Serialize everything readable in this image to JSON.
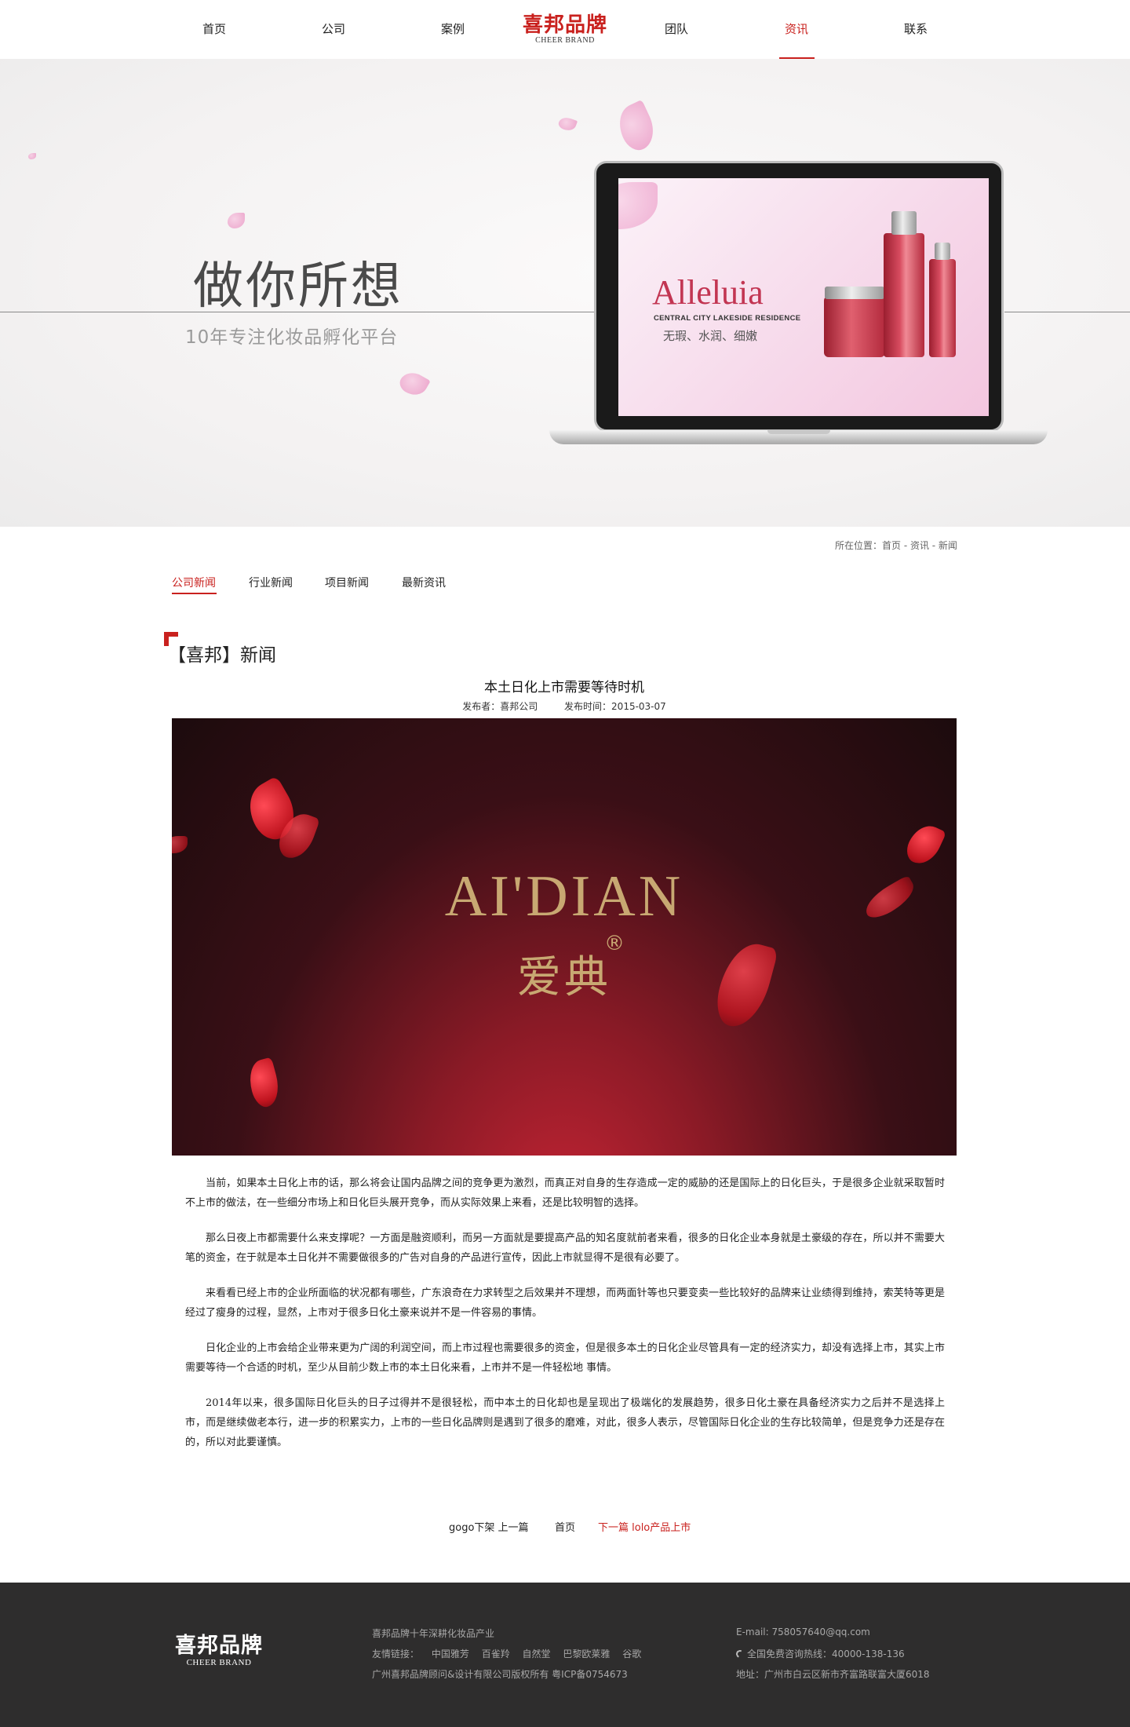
{
  "nav": {
    "items": [
      {
        "label": "首页"
      },
      {
        "label": "公司"
      },
      {
        "label": "案例"
      },
      {
        "label": "团队"
      },
      {
        "label": "资讯"
      },
      {
        "label": "联系"
      }
    ],
    "active_index": 4,
    "logo_cn": "喜邦品牌",
    "logo_en": "CHEER BRAND"
  },
  "banner": {
    "title": "做你所想",
    "subtitle": "10年专注化妆品孵化平台",
    "screen": {
      "brand": "Alleluia",
      "brand_sub": "CENTRAL CITY LAKESIDE RESIDENCE",
      "tagline": "无瑕、水润、细嫩"
    }
  },
  "breadcrumb": "所在位置：首页 - 资讯 - 新闻",
  "subnav": {
    "items": [
      {
        "label": "公司新闻"
      },
      {
        "label": "行业新闻"
      },
      {
        "label": "项目新闻"
      },
      {
        "label": "最新资讯"
      }
    ],
    "active_index": 0
  },
  "section_title": "【喜邦】新闻",
  "article": {
    "title": "本土日化上市需要等待时机",
    "publisher": "发布者：喜邦公司",
    "date": "发布时间：2015-03-07",
    "image": {
      "brand_en": "AI'DIAN",
      "brand_cn": "爱典",
      "reg_mark": "®"
    },
    "paragraphs": [
      "当前，如果本土日化上市的话，那么将会让国内品牌之间的竞争更为激烈，而真正对自身的生存造成一定的威胁的还是国际上的日化巨头，于是很多企业就采取暂时不上市的做法，在一些细分市场上和日化巨头展开竞争，而从实际效果上来看，还是比较明智的选择。",
      "那么日夜上市都需要什么来支撑呢？一方面是融资顺利，而另一方面就是要提高产品的知名度就前者来看，很多的日化企业本身就是土豪级的存在，所以并不需要大笔的资金，在于就是本土日化并不需要做很多的广告对自身的产品进行宣传，因此上市就显得不是很有必要了。",
      "来看看已经上市的企业所面临的状况都有哪些，广东浪奇在力求转型之后效果并不理想，而两面针等也只要变卖一些比较好的品牌来让业绩得到维持，索芙特等更是经过了瘦身的过程，显然，上市对于很多日化土豪来说并不是一件容易的事情。",
      "日化企业的上市会给企业带来更为广阔的利润空间，而上市过程也需要很多的资金，但是很多本土的日化企业尽管具有一定的经济实力，却没有选择上市，其实上市需要等待一个合适的时机，至少从目前少数上市的本土日化来看，上市并不是一件轻松地 事情。",
      "2014年以来，很多国际日化巨头的日子过得并不是很轻松，而中本土的日化却也是呈现出了极端化的发展趋势，很多日化土豪在具备经济实力之后并不是选择上市，而是继续做老本行，进一步的积累实力，上市的一些日化品牌则是遇到了很多的磨难，对此，很多人表示，尽管国际日化企业的生存比较简单，但是竞争力还是存在的，所以对此要谨慎。"
    ]
  },
  "pager": {
    "prev": "gogo下架  上一篇",
    "home": "首页",
    "next": "下一篇  lolo产品上市"
  },
  "footer": {
    "logo_cn": "喜邦品牌",
    "logo_en": "CHEER BRAND",
    "slogan": "喜邦品牌十年深耕化妆品产业",
    "links_label": "友情链接：",
    "links": [
      "中国雅芳",
      "百雀羚",
      "自然堂",
      "巴黎欧莱雅",
      "谷歌"
    ],
    "copyright": "广州喜邦品牌顾问&设计有限公司版权所有    粤ICP备0754673",
    "email": "E-mail: 758057640@qq.com",
    "hotline": "全国免费咨询热线：40000-138-136",
    "address": "地址：广州市白云区新市齐富路联富大厦6018"
  },
  "colors": {
    "accent": "#c9211e",
    "footer_bg": "#2e2d2d",
    "gold": "#c8a872"
  }
}
